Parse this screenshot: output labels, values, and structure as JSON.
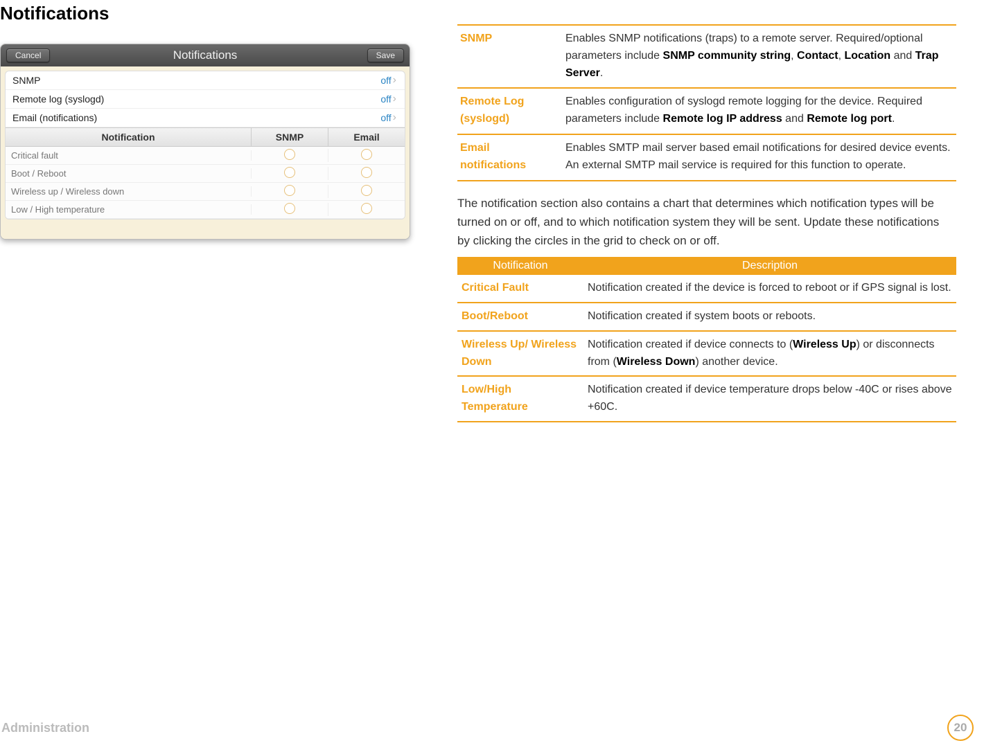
{
  "pageTitle": "Notifications",
  "panel": {
    "title": "Notifications",
    "cancel": "Cancel",
    "save": "Save",
    "settings": [
      {
        "label": "SNMP",
        "value": "off"
      },
      {
        "label": "Remote log (syslogd)",
        "value": "off"
      },
      {
        "label": "Email (notifications)",
        "value": "off"
      }
    ],
    "gridHeaders": {
      "notif": "Notification",
      "snmp": "SNMP",
      "email": "Email"
    },
    "gridRows": [
      "Critical fault",
      "Boot / Reboot",
      "Wireless up / Wireless down",
      "Low / High temperature"
    ]
  },
  "definitions": [
    {
      "label": "SNMP",
      "descParts": [
        "Enables SNMP notifications (traps) to a remote server. Required/optional parameters include ",
        "SNMP community string",
        ", ",
        "Contact",
        ", ",
        "Location",
        " and ",
        "Trap Server",
        "."
      ]
    },
    {
      "label": "Remote Log (syslogd)",
      "descParts": [
        "Enables configuration of syslogd remote logging for the device. Required parameters include ",
        "Remote log IP address",
        " and ",
        "Remote log port",
        "."
      ]
    },
    {
      "label": "Email notifications",
      "descParts": [
        "Enables SMTP mail server based email notifications for desired device events. An external SMTP mail service is required for this function to operate."
      ]
    }
  ],
  "paragraph1": "The notification section also contains a chart that determines which notification types will be turned on or off, and to which notification system they will be sent. Update these notifications",
  "paragraph2": "by clicking the circles in the grid to check on or off.",
  "notifHeaders": {
    "n": "Notification",
    "d": "Description"
  },
  "notifRows": [
    {
      "label": "Critical Fault",
      "descParts": [
        "Notification created if the device is forced to reboot or if GPS signal is lost."
      ]
    },
    {
      "label": "Boot/Reboot",
      "descParts": [
        "Notification created if system boots or reboots."
      ]
    },
    {
      "label": "Wireless Up/ Wireless Down",
      "descParts": [
        "Notification created if device connects to (",
        "Wireless Up",
        ") or disconnects from (",
        "Wireless Down",
        ") another device."
      ]
    },
    {
      "label": "Low/High Temperature",
      "descParts": [
        "Notification created if device temperature drops below -40C or rises above +60C."
      ]
    }
  ],
  "footerLeft": "Administration",
  "pageNumber": "20"
}
